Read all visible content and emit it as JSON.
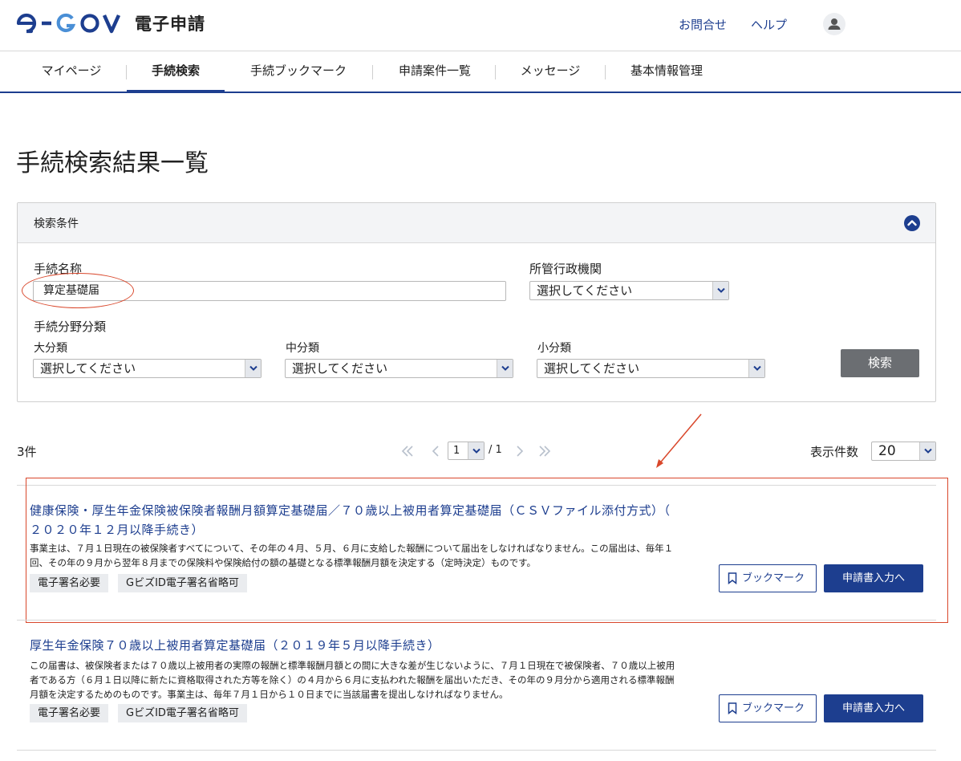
{
  "header": {
    "logo_text": "e-GOV",
    "app_name": "電子申請",
    "contact_link": "お問合せ",
    "help_link": "ヘルプ"
  },
  "tabs": [
    {
      "label": "マイページ"
    },
    {
      "label": "手続検索"
    },
    {
      "label": "手続ブックマーク"
    },
    {
      "label": "申請案件一覧"
    },
    {
      "label": "メッセージ"
    },
    {
      "label": "基本情報管理"
    }
  ],
  "page_title": "手続検索結果一覧",
  "search_panel": {
    "title": "検索条件",
    "procedure_name_label": "手続名称",
    "procedure_name_value": "算定基礎届",
    "agency_label": "所管行政機関",
    "agency_value": "選択してください",
    "field_category_label": "手続分野分類",
    "large_label": "大分類",
    "large_value": "選択してください",
    "medium_label": "中分類",
    "medium_value": "選択してください",
    "small_label": "小分類",
    "small_value": "選択してください",
    "search_button": "検索"
  },
  "results_bar": {
    "count": "3件",
    "current_page": "1",
    "total_pages": "/ 1",
    "per_page_label": "表示件数",
    "per_page_value": "20"
  },
  "results": [
    {
      "title_line1": "健康保険・厚生年金保険被保険者報酬月額算定基礎届／７０歳以上被用者算定基礎届（ＣＳＶファイル添付方式）（",
      "title_line2": "２０２０年１２月以降手続き）",
      "desc_line1": "事業主は、７月１日現在の被保険者すべてについて、その年の４月、５月、６月に支給した報酬について届出をしなければなりません。この届出は、毎年１",
      "desc_line2": "回、その年の９月から翌年８月までの保険料や保険給付の額の基礎となる標準報酬月額を決定する（定時決定）ものです。",
      "tags": [
        "電子署名必要",
        "GビズID電子署名省略可"
      ],
      "bookmark_label": "ブックマーク",
      "apply_label": "申請書入力へ"
    },
    {
      "title_line1": "厚生年金保険７０歳以上被用者算定基礎届（２０１９年５月以降手続き）",
      "desc_line1": "この届書は、被保険者または７０歳以上被用者の実際の報酬と標準報酬月額との間に大きな差が生じないように、７月１日現在で被保険者、７０歳以上被用",
      "desc_line2": "者である方（６月１日以降に新たに資格取得された方等を除く）の４月から６月に支払われた報酬を届出いただき、その年の９月分から適用される標準報酬",
      "desc_line3": "月額を決定するためのものです。事業主は、毎年７月１日から１０日までに当該届書を提出しなければなりません。",
      "tags": [
        "電子署名必要",
        "GビズID電子署名省略可"
      ],
      "bookmark_label": "ブックマーク",
      "apply_label": "申請書入力へ"
    }
  ],
  "colors": {
    "brand_navy": "#1d3e8f",
    "logo_blue": "#4a8fd6",
    "search_button": "#6b6e72",
    "annotation_red": "#d9472b"
  }
}
